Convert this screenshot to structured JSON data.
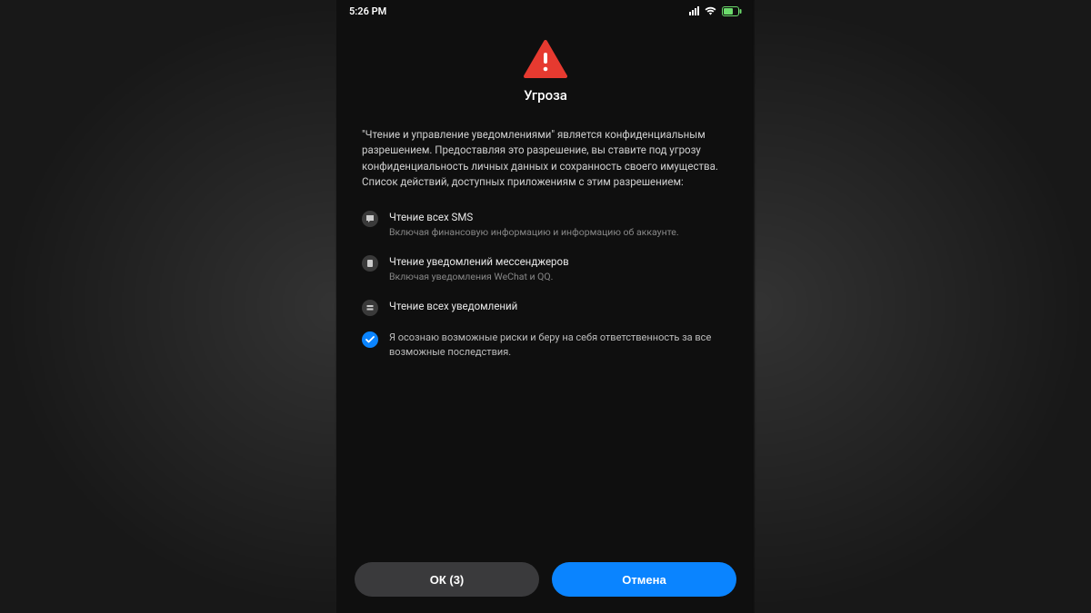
{
  "status": {
    "time": "5:26 PM"
  },
  "dialog": {
    "title": "Угроза",
    "body": "\"Чтение и управление уведомлениями\" является конфиденциальным разрешением. Предоставляя это разрешение, вы ставите под угрозу конфиденциальность личных данных и сохранность своего имущества. Список действий, доступных приложениям с этим разрешением:",
    "permissions": [
      {
        "title": "Чтение всех SMS",
        "sub": "Включая финансовую информацию и информацию об аккаунте."
      },
      {
        "title": "Чтение уведомлений мессенджеров",
        "sub": "Включая уведомления WeChat и QQ."
      },
      {
        "title": "Чтение всех уведомлений",
        "sub": ""
      }
    ],
    "consent": "Я осознаю возможные риски и беру на себя ответственность за все возможные последствия.",
    "ok_label": "ОК (3)",
    "cancel_label": "Отмена"
  }
}
